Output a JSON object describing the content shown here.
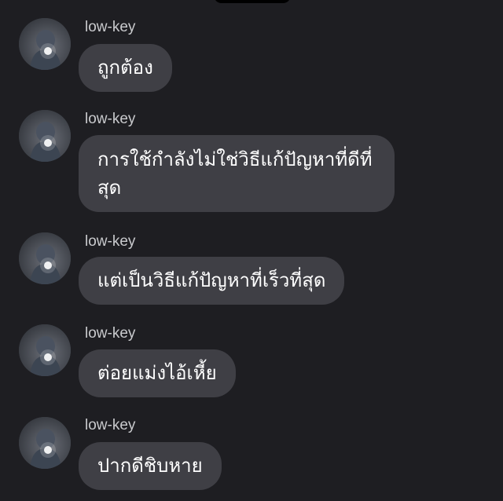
{
  "messages": [
    {
      "sender": "low-key",
      "text": "ถูกต้อง"
    },
    {
      "sender": "low-key",
      "text": "การใช้กำลังไม่ใช่วิธีแก้ปัญหาที่ดีที่สุด"
    },
    {
      "sender": "low-key",
      "text": "แต่เป็นวิธีแก้ปัญหาที่เร็วที่สุด"
    },
    {
      "sender": "low-key",
      "text": "ต่อยแม่งไอ้เหี้ย"
    },
    {
      "sender": "low-key",
      "text": "ปากดีชิบหาย"
    }
  ],
  "colors": {
    "background": "#1e1e22",
    "bubble": "#3f3f45",
    "sender_text": "#c9cacd",
    "message_text": "#ffffff"
  }
}
